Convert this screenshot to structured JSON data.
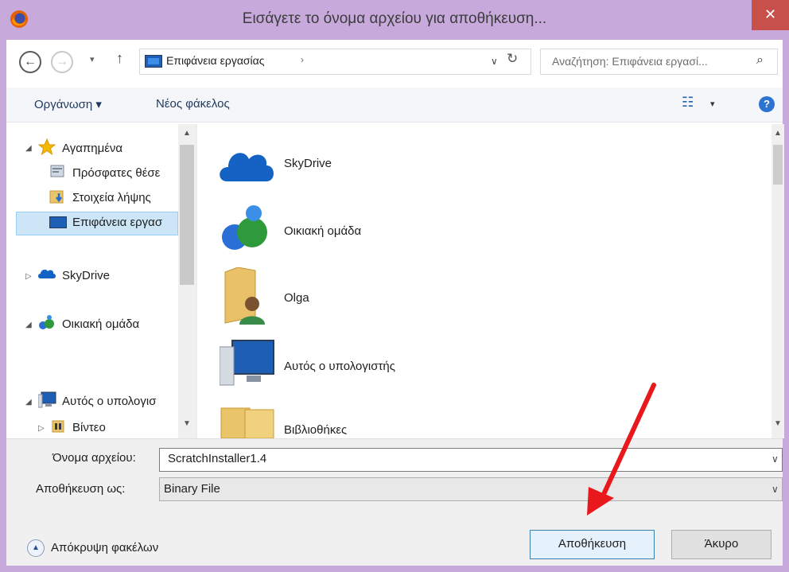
{
  "window": {
    "title": "Εισάγετε το όνομα αρχείου για αποθήκευση...",
    "close_glyph": "✕"
  },
  "nav": {
    "back_glyph": "←",
    "forward_glyph": "→",
    "recent_glyph": "▾",
    "up_glyph": "↑",
    "address": "Επιφάνεια εργασίας",
    "address_chevron": "›",
    "address_dropdown": "∨",
    "refresh_glyph": "↻",
    "search_placeholder": "Αναζήτηση: Επιφάνεια εργασί...",
    "search_glyph": "⌕"
  },
  "toolbar": {
    "organize": "Οργάνωση ▾",
    "new_folder": "Νέος φάκελος",
    "view_glyph": "☷",
    "view_dropdown": "▾",
    "help_glyph": "?"
  },
  "tree": {
    "items": [
      {
        "label": "Αγαπημένα",
        "icon": "star-icon"
      },
      {
        "label": "Πρόσφατες θέσε",
        "icon": "recent-places-icon"
      },
      {
        "label": "Στοιχεία λήψης",
        "icon": "downloads-icon"
      },
      {
        "label": "Επιφάνεια εργασ",
        "icon": "desktop-icon"
      },
      {
        "label": "SkyDrive",
        "icon": "skydrive-icon"
      },
      {
        "label": "Οικιακή ομάδα",
        "icon": "homegroup-icon"
      },
      {
        "label": "Αυτός ο υπολογισ",
        "icon": "computer-icon"
      },
      {
        "label": "Βίντεο",
        "icon": "videos-icon"
      }
    ],
    "expanded_glyph": "◢",
    "collapsed_glyph": "▷",
    "scroll_up": "▲",
    "scroll_down": "▼"
  },
  "files": {
    "items": [
      {
        "label": "SkyDrive",
        "icon": "skydrive-icon"
      },
      {
        "label": "Οικιακή ομάδα",
        "icon": "homegroup-icon"
      },
      {
        "label": "Olga",
        "icon": "user-folder-icon"
      },
      {
        "label": "Αυτός ο υπολογιστής",
        "icon": "computer-icon"
      },
      {
        "label": "Βιβλιοθήκες",
        "icon": "libraries-icon"
      }
    ],
    "scroll_up": "▲",
    "scroll_down": "▼"
  },
  "form": {
    "filename_label": "Όνομα αρχείου:",
    "filename_value": "ScratchInstaller1.4",
    "savetype_label": "Αποθήκευση ως:",
    "savetype_value": "Binary File",
    "dropdown_glyph": "∨",
    "hide_folders_glyph": "▲",
    "hide_folders_label": "Απόκρυψη φακέλων",
    "save_label": "Αποθήκευση",
    "cancel_label": "Άκυρο"
  },
  "colors": {
    "titlebar": "#c7a9dc",
    "close": "#c7504b",
    "selection": "#cce6f7",
    "annotation_arrow": "#e8181c"
  }
}
